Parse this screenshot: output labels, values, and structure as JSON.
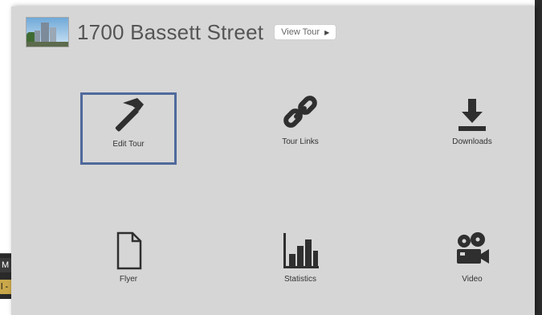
{
  "header": {
    "title": "1700 Bassett Street",
    "view_tour_label": "View Tour",
    "thumbnail_icon": "building-thumbnail"
  },
  "tiles": [
    {
      "label": "Edit Tour",
      "icon": "hammer-icon",
      "selected": true
    },
    {
      "label": "Tour Links",
      "icon": "link-icon"
    },
    {
      "label": "Downloads",
      "icon": "download-icon"
    },
    {
      "label": "Flyer",
      "icon": "file-icon"
    },
    {
      "label": "Statistics",
      "icon": "bar-chart-icon"
    },
    {
      "label": "Video",
      "icon": "video-camera-icon"
    }
  ],
  "peek_window": {
    "line1": "M",
    "line2": "l -"
  },
  "colors": {
    "panel_bg": "#d6d6d6",
    "selected_border": "#4f6a9c",
    "icon_color": "#2f2f2f"
  }
}
